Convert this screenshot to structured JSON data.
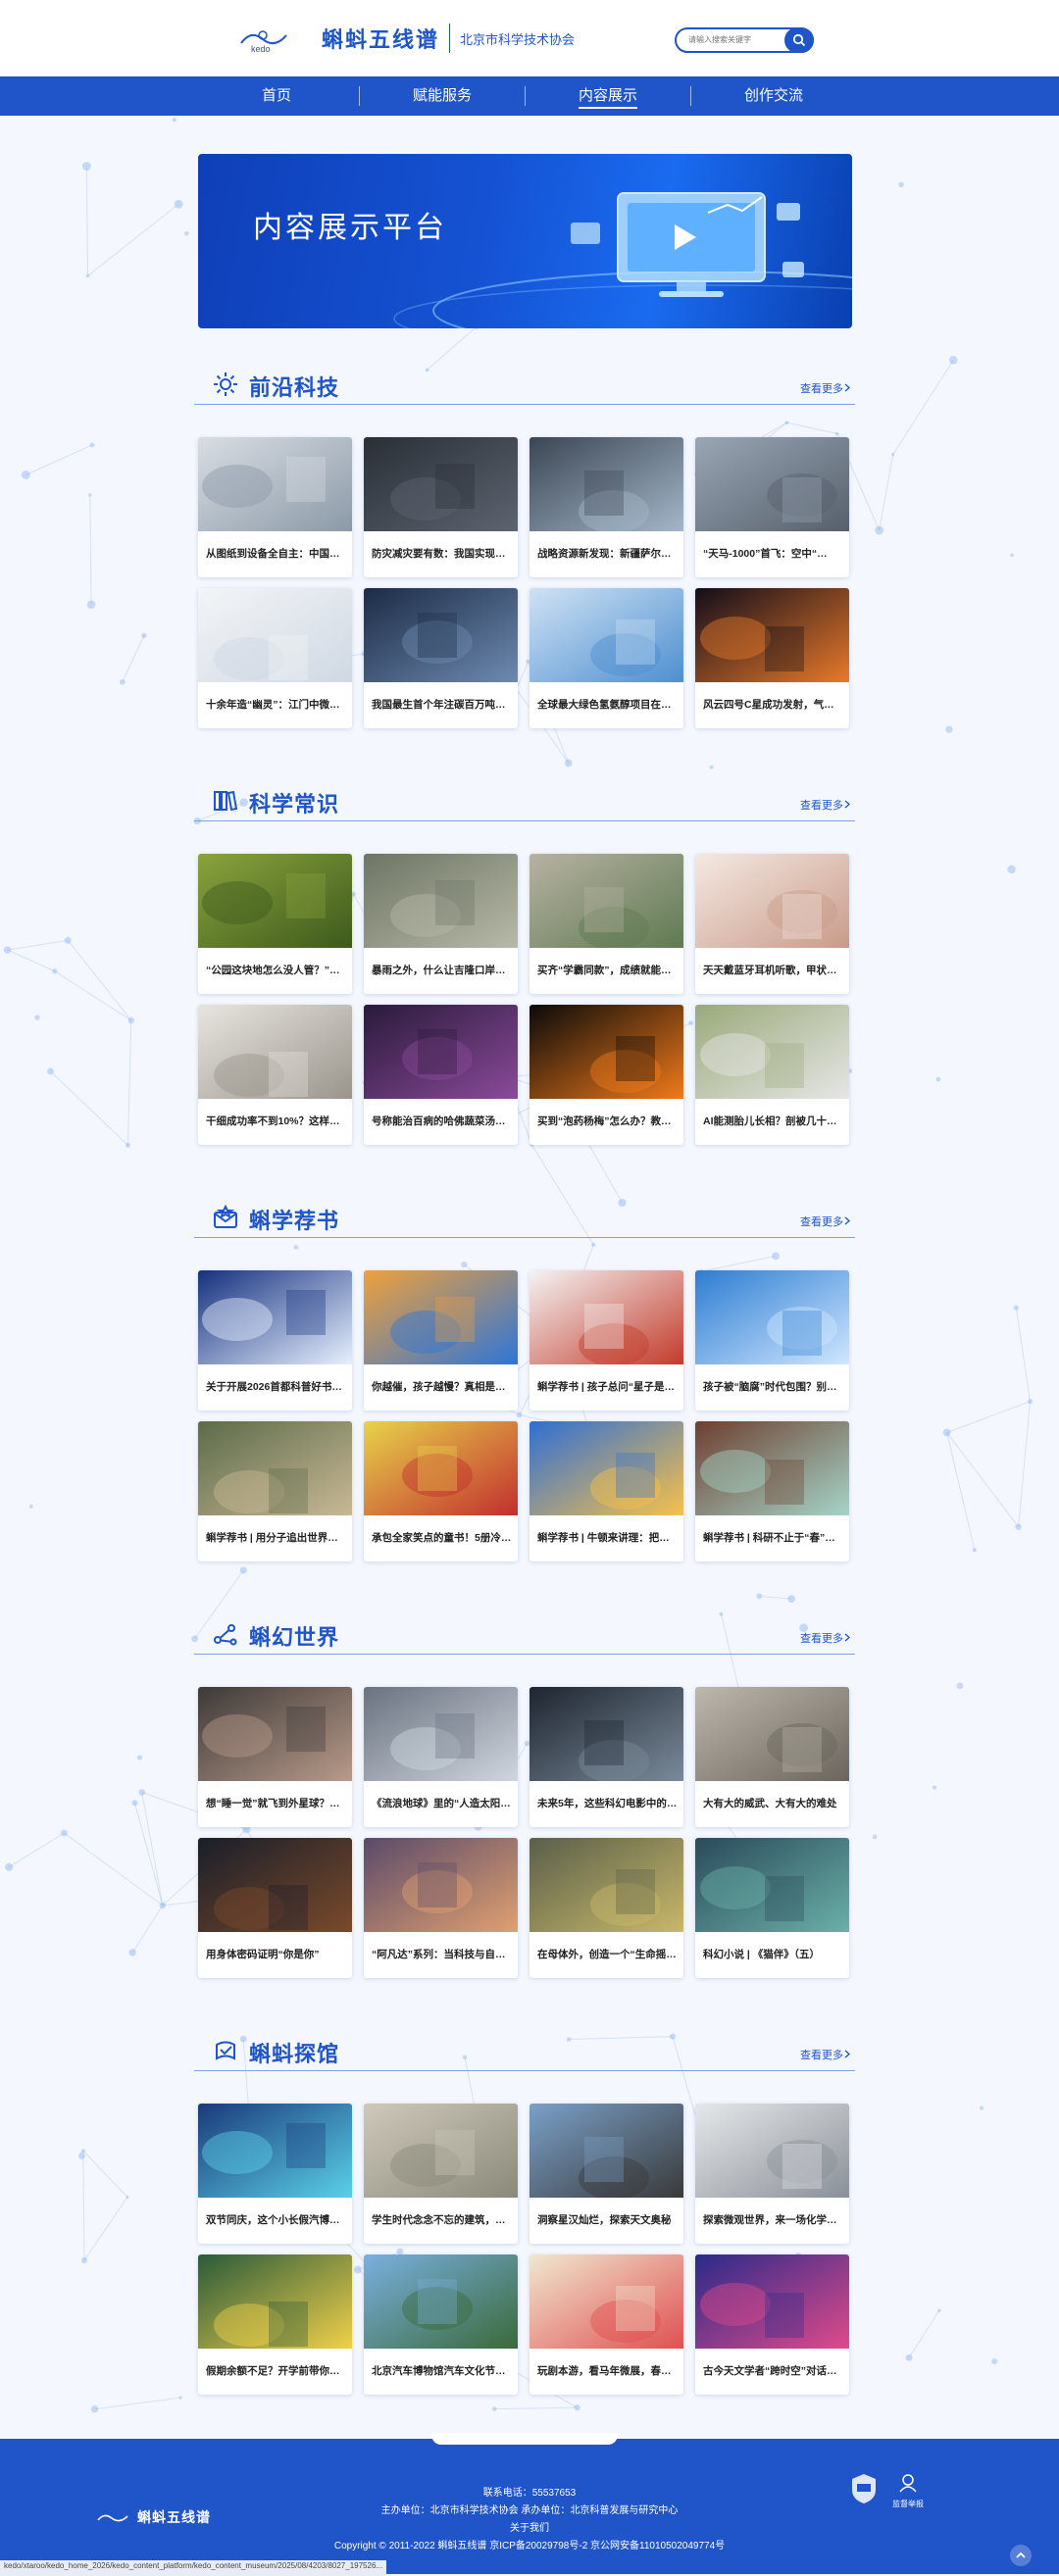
{
  "header": {
    "logo_text": "蝌蚪五线谱",
    "logo_sub": "北京市科学技术协会",
    "search_placeholder": "请输入搜索关键字"
  },
  "nav": [
    "首页",
    "赋能服务",
    "内容展示",
    "创作交流"
  ],
  "banner": {
    "title": "内容展示平台"
  },
  "sections": [
    {
      "title": "前沿科技",
      "more": "查看更多",
      "items": [
        "从图纸到设备全自主：中国显…",
        "防灾减灾要有数：我国实现强…",
        "战略资源新发现：新疆萨尔托…",
        "“天马-1000”首飞：空中“…",
        "十余年造“幽灵”：江门中微…",
        "我国最生首个年注碳百万吨油…",
        "全球最大绿色氢氨醇项目在吉…",
        "风云四号C星成功发射，气象…"
      ]
    },
    {
      "title": "科学常识",
      "more": "查看更多",
      "items": [
        "“公园这块地怎么没人管？”…",
        "暴雨之外，什么让吉隆口岸泥…",
        "买齐“学霸同款”，成绩就能…",
        "天天戴蓝牙耳机听歌，甲状腺…",
        "干细成功率不到10%？这样…",
        "号称能治百病的哈佛蔬菜汤，…",
        "买到“泡药杨梅”怎么办？教你…",
        "AI能测胎儿长相？剖被几十…"
      ]
    },
    {
      "title": "蝌学荐书",
      "more": "查看更多",
      "items": [
        "关于开展2026首都科普好书…",
        "你越催，孩子越慢？真相是：…",
        "蝌学荐书 | 孩子总问“星子是…",
        "孩子被“脑腐”时代包围？别…",
        "蝌学荐书 | 用分子追出世界上…",
        "承包全家笑点的童书！5册冷…",
        "蝌学荐书 | 牛顿来讲理：把魔…",
        "蝌学荐书 | 科研不止于“春”…"
      ]
    },
    {
      "title": "蝌幻世界",
      "more": "查看更多",
      "items": [
        "想“睡一觉”就飞到外星球？你…",
        "《流浪地球》里的“人造太阳…",
        "未来5年，这些科幻电影中的…",
        "大有大的威武、大有大的难处",
        "用身体密码证明“你是你”",
        "“阿凡达”系列：当科技与自…",
        "在母体外，创造一个“生命摇…",
        "科幻小说 | 《猫伴》（五）"
      ]
    },
    {
      "title": "蝌蚪探馆",
      "more": "查看更多",
      "items": [
        "双节同庆，这个小长假汽博…",
        "学生时代念念不忘的建筑，总…",
        "洞察星汉灿烂，探索天文奥秘",
        "探索微观世界，来一场化学课…",
        "假期余额不足？开学前带你玩…",
        "北京汽车博物馆汽车文化节暨…",
        "玩剧本游，看马年微展，春节…",
        "古今天文学者“跨时空”对话…"
      ]
    }
  ],
  "footer": {
    "logo_text": "蝌蚪五线谱",
    "phone": "联系电话：55537653",
    "host": "主办单位：北京市科学技术协会  承办单位：北京科普发展与研究中心",
    "about": "关于我们",
    "copyright": "Copyright © 2011-2022 蝌蚪五线谱 京ICP备20029798号-2 京公网安备11010502049774号",
    "badge1": "",
    "badge2": "监督举报"
  },
  "status_url": "kedo/xtaroo/kedo_home_2026/kedo_content_platform/kedo_content_museum/2025/08/4203/8027_197526..."
}
